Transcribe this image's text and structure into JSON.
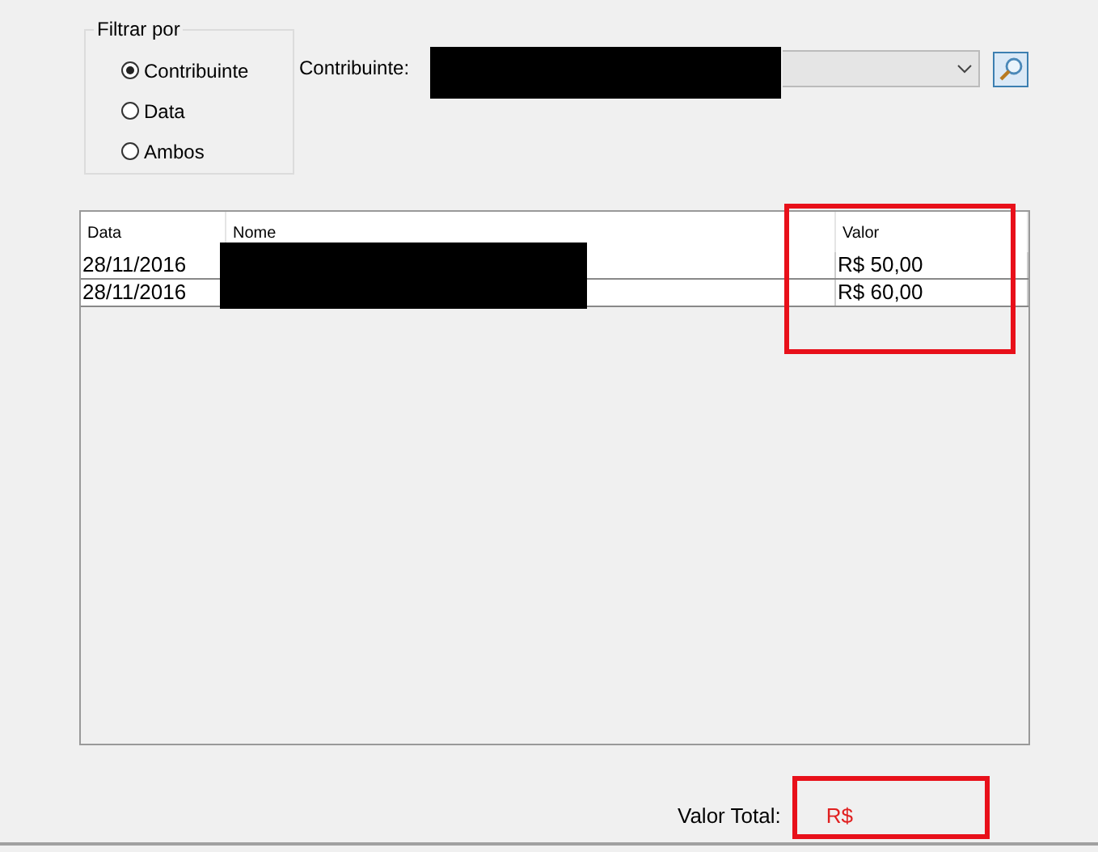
{
  "filter_group": {
    "title": "Filtrar por",
    "options": [
      {
        "label": "Contribuinte",
        "selected": true
      },
      {
        "label": "Data",
        "selected": false
      },
      {
        "label": "Ambos",
        "selected": false
      }
    ]
  },
  "contribuinte": {
    "label": "Contribuinte:"
  },
  "table": {
    "columns": [
      "Data",
      "Nome",
      "Valor"
    ],
    "rows": [
      {
        "data": "28/11/2016",
        "valor": "R$ 50,00"
      },
      {
        "data": "28/11/2016",
        "valor": "R$ 60,00"
      }
    ]
  },
  "total": {
    "label": "Valor Total:",
    "value": "R$"
  }
}
